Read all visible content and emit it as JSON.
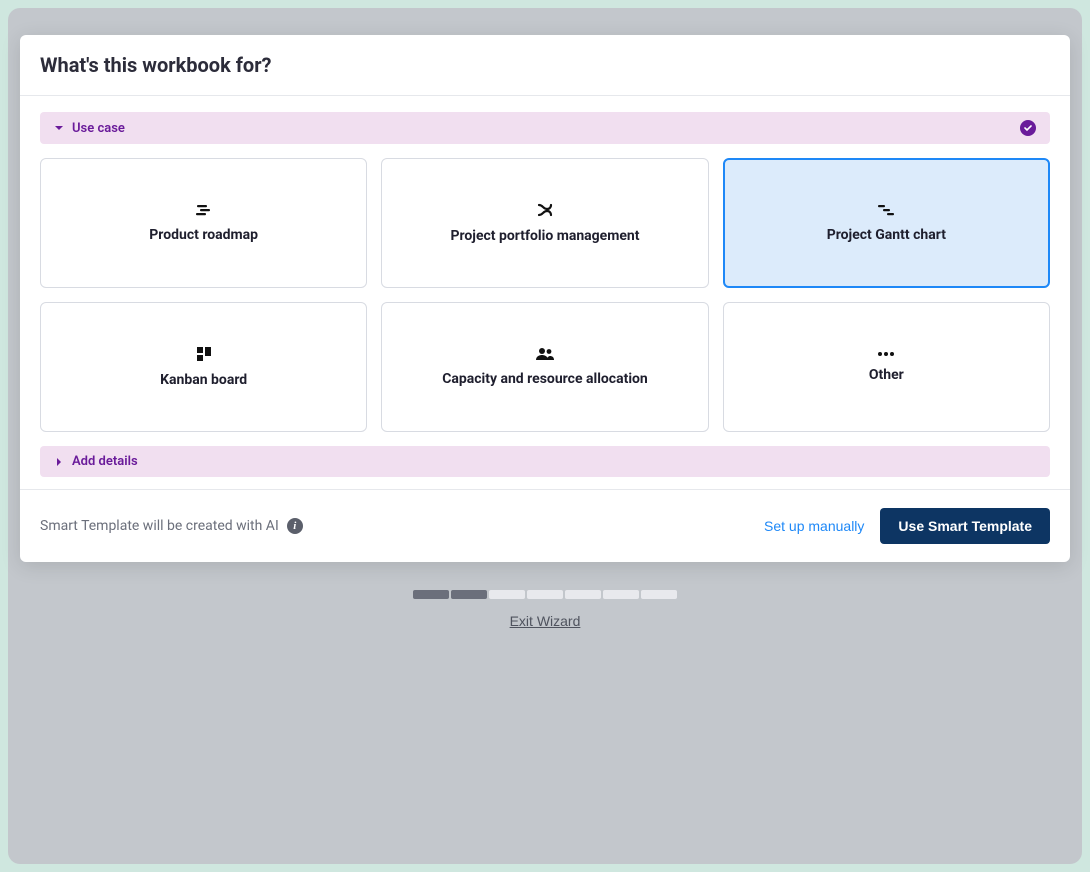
{
  "header": {
    "title": "What's this workbook for?"
  },
  "sections": {
    "usecase": {
      "label": "Use case",
      "expanded": true,
      "completed": true
    },
    "details": {
      "label": "Add details",
      "expanded": false
    }
  },
  "cards": [
    {
      "id": "product-roadmap",
      "label": "Product roadmap",
      "icon": "roadmap",
      "selected": false
    },
    {
      "id": "project-portfolio",
      "label": "Project portfolio management",
      "icon": "portfolio",
      "selected": false
    },
    {
      "id": "gantt-chart",
      "label": "Project Gantt chart",
      "icon": "gantt",
      "selected": true
    },
    {
      "id": "kanban-board",
      "label": "Kanban board",
      "icon": "kanban",
      "selected": false
    },
    {
      "id": "capacity",
      "label": "Capacity and resource allocation",
      "icon": "people",
      "selected": false
    },
    {
      "id": "other",
      "label": "Other",
      "icon": "dots",
      "selected": false
    }
  ],
  "footer": {
    "note": "Smart Template will be created with AI",
    "manual_label": "Set up manually",
    "primary_label": "Use Smart Template"
  },
  "progress": {
    "current": 2,
    "total": 7
  },
  "exit_label": "Exit Wizard"
}
